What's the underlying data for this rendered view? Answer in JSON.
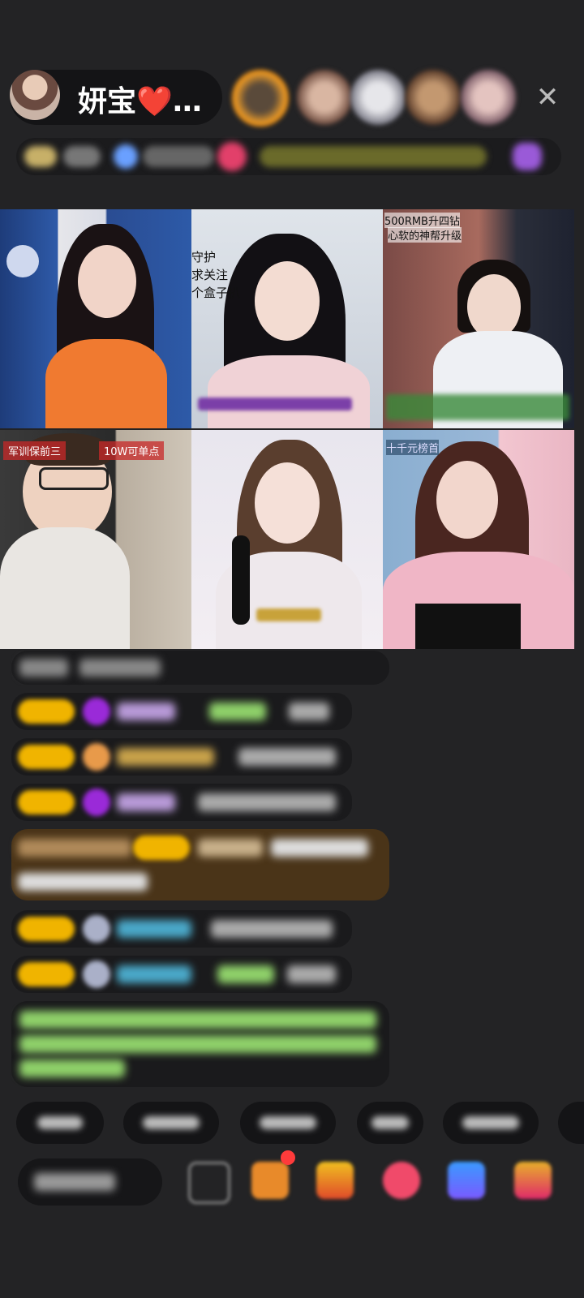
{
  "header": {
    "host_name": "妍宝❤️…",
    "close_icon": "close-icon"
  },
  "video_grid": {
    "tiles": [
      {
        "id": "tile-1"
      },
      {
        "id": "tile-2",
        "overlay": [
          "守护",
          "求关注",
          "个盒子扒"
        ]
      },
      {
        "id": "tile-3",
        "overlay": [
          "500RMB升四钻",
          "心软的神帮升级"
        ]
      },
      {
        "id": "tile-4",
        "overlay": [
          "军训保前三",
          "10W可单点"
        ]
      },
      {
        "id": "tile-5"
      },
      {
        "id": "tile-6",
        "overlay": [
          "十千元榜首"
        ]
      }
    ]
  },
  "colors": {
    "background": "#232325",
    "badge_gold": "#f0b400",
    "notice_green": "#8fd16a"
  }
}
